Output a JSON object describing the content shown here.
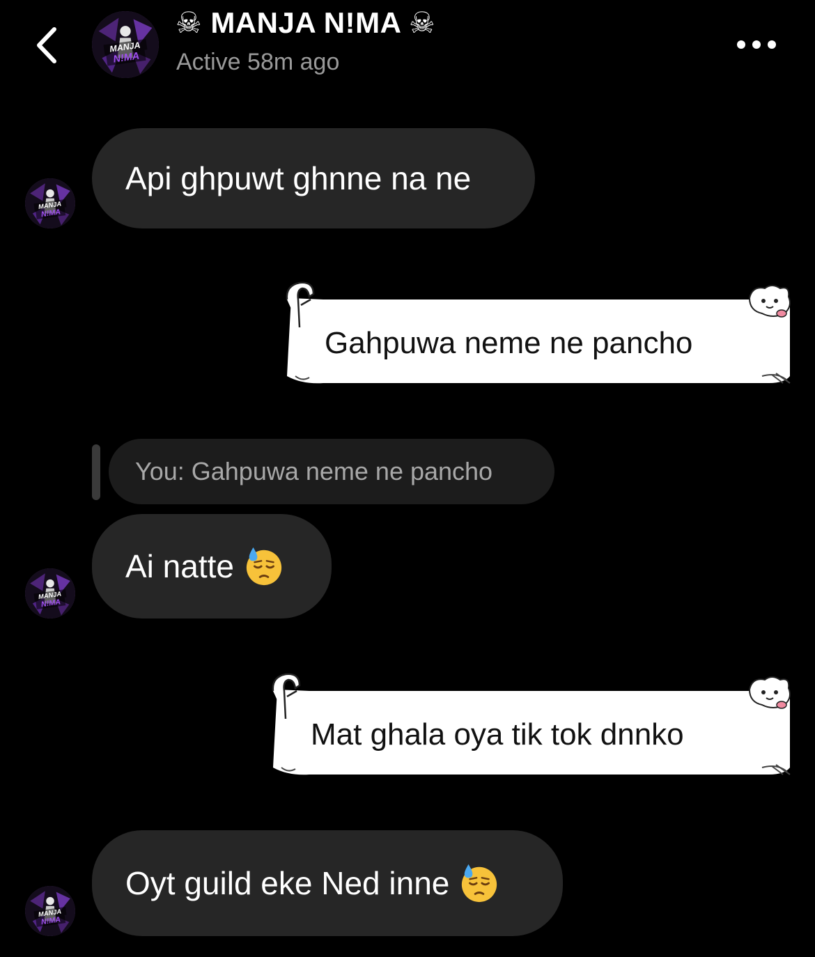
{
  "header": {
    "contact_name": "☠ MANJA N!MA ☠",
    "status": "Active 58m ago",
    "avatar_text_top": "MANJA",
    "avatar_text_bottom": "N!MA"
  },
  "messages": [
    {
      "direction": "incoming",
      "text": "Api ghpuwt ghnne na ne"
    },
    {
      "direction": "outgoing",
      "text": "Gahpuwa neme ne pancho"
    },
    {
      "direction": "reply_preview",
      "text": "You: Gahpuwa neme ne pancho"
    },
    {
      "direction": "incoming",
      "text": "Ai natte",
      "emoji": "downcast-face-with-sweat"
    },
    {
      "direction": "outgoing",
      "text": "Mat ghala oya tik tok dnnko"
    },
    {
      "direction": "incoming",
      "text": "Oyt guild eke Ned inne",
      "emoji": "downcast-face-with-sweat"
    }
  ],
  "colors": {
    "background": "#000000",
    "incoming_bubble": "#262626",
    "outgoing_bubble": "#ffffff",
    "status_text": "#9a9a9a",
    "avatar_accent": "#8a3dd6"
  }
}
